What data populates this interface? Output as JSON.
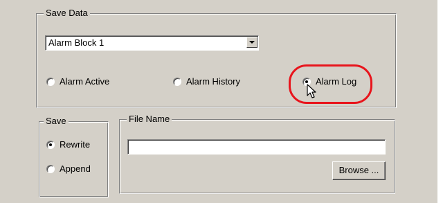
{
  "save_data": {
    "legend": "Save Data",
    "dropdown": {
      "selected": "Alarm Block 1"
    },
    "options": [
      {
        "label": "Alarm Active",
        "checked": false
      },
      {
        "label": "Alarm History",
        "checked": false
      },
      {
        "label": "Alarm Log",
        "checked": true
      }
    ]
  },
  "save": {
    "legend": "Save",
    "options": [
      {
        "label": "Rewrite",
        "checked": true
      },
      {
        "label": "Append",
        "checked": false
      }
    ]
  },
  "file_name": {
    "legend": "File Name",
    "value": "",
    "browse_label": "Browse ..."
  },
  "highlight_color": "#e8141c"
}
